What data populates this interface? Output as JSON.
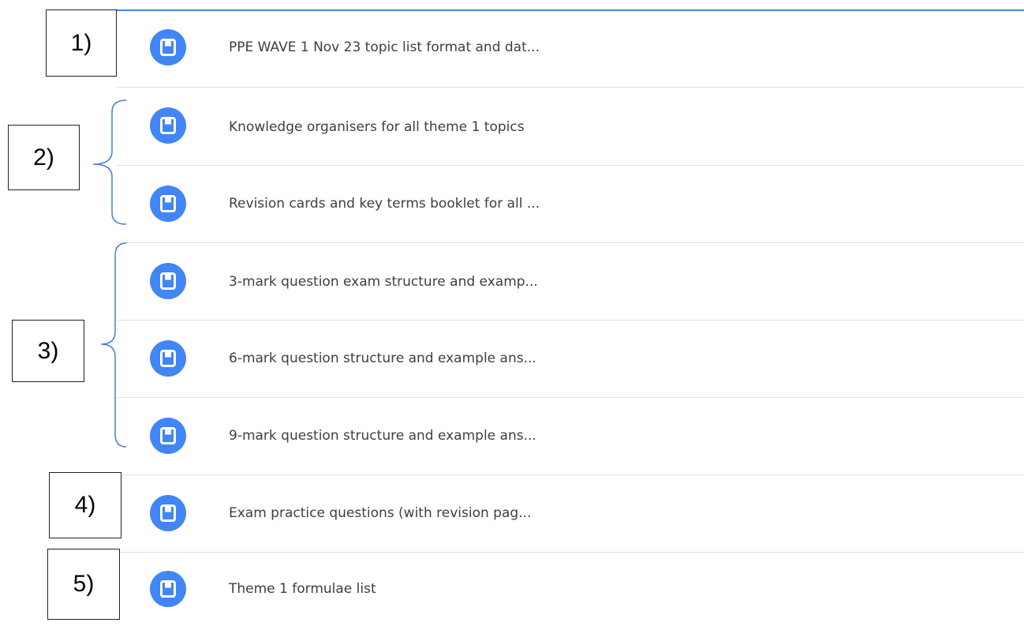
{
  "colors": {
    "accent": "#4285f4",
    "top_border": "#4a86e8",
    "brace": "#4a7bd0",
    "divider": "#e0e0e0",
    "text": "#3c4043"
  },
  "materials": [
    {
      "title": "PPE WAVE 1 Nov 23 topic list format and dat...",
      "icon": "document-icon"
    },
    {
      "title": "Knowledge organisers for all theme 1 topics",
      "icon": "document-icon"
    },
    {
      "title": "Revision cards and key terms booklet for all ...",
      "icon": "document-icon"
    },
    {
      "title": "3-mark question exam structure and examp...",
      "icon": "document-icon"
    },
    {
      "title": "6-mark question structure and example ans...",
      "icon": "document-icon"
    },
    {
      "title": "9-mark question structure and example ans...",
      "icon": "document-icon"
    },
    {
      "title": "Exam practice questions (with revision pag...",
      "icon": "document-icon"
    },
    {
      "title": "Theme 1 formulae list",
      "icon": "document-icon"
    }
  ],
  "annotations": [
    {
      "label": "1)"
    },
    {
      "label": "2)"
    },
    {
      "label": "3)"
    },
    {
      "label": "4)"
    },
    {
      "label": "5)"
    }
  ]
}
